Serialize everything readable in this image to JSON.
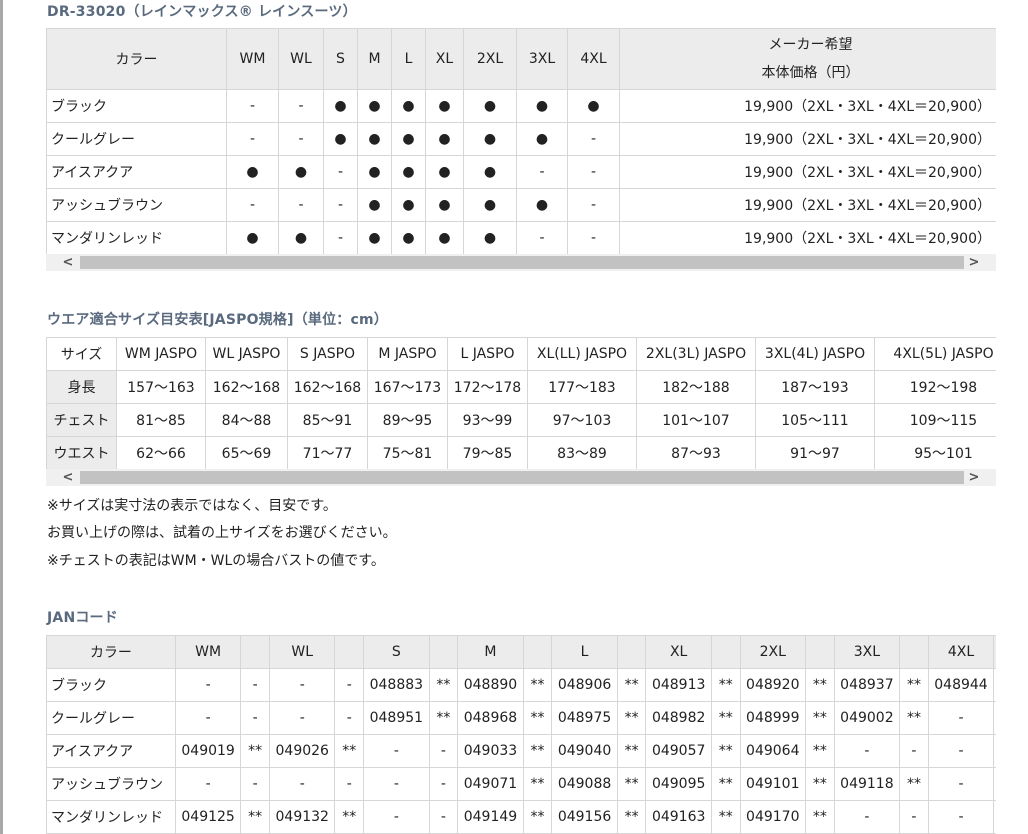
{
  "headings": {
    "model": "DR-33020（レインマックス® レインスーツ）",
    "size_chart": "ウエア適合サイズ目安表[JASPO規格]（単位：cm）",
    "jan": "JANコード"
  },
  "colors_table": {
    "header": [
      "カラー",
      "WM",
      "WL",
      "S",
      "M",
      "L",
      "XL",
      "2XL",
      "3XL",
      "4XL"
    ],
    "price_header_line1": "メーカー希望",
    "price_header_line2": "本体価格（円）",
    "rows": [
      {
        "cells": [
          "ブラック",
          "-",
          "-",
          "●",
          "●",
          "●",
          "●",
          "●",
          "●",
          "●"
        ],
        "price": "19,900（2XL・3XL・4XL＝20,900）"
      },
      {
        "cells": [
          "クールグレー",
          "-",
          "-",
          "●",
          "●",
          "●",
          "●",
          "●",
          "●",
          "-"
        ],
        "price": "19,900（2XL・3XL・4XL＝20,900）"
      },
      {
        "cells": [
          "アイスアクア",
          "●",
          "●",
          "-",
          "●",
          "●",
          "●",
          "●",
          "-",
          "-"
        ],
        "price": "19,900（2XL・3XL・4XL＝20,900）"
      },
      {
        "cells": [
          "アッシュブラウン",
          "-",
          "-",
          "-",
          "●",
          "●",
          "●",
          "●",
          "●",
          "-"
        ],
        "price": "19,900（2XL・3XL・4XL＝20,900）"
      },
      {
        "cells": [
          "マンダリンレッド",
          "●",
          "●",
          "-",
          "●",
          "●",
          "●",
          "●",
          "-",
          "-"
        ],
        "price": "19,900（2XL・3XL・4XL＝20,900）"
      }
    ]
  },
  "size_table": {
    "header": [
      "サイズ",
      "WM JASPO",
      "WL JASPO",
      "S JASPO",
      "M JASPO",
      "L JASPO",
      "XL(LL) JASPO",
      "2XL(3L) JASPO",
      "3XL(4L) JASPO",
      "4XL(5L) JASPO"
    ],
    "rows": [
      [
        "身長",
        "157～163",
        "162～168",
        "162～168",
        "167～173",
        "172～178",
        "177～183",
        "182～188",
        "187～193",
        "192～198"
      ],
      [
        "チェスト",
        "81～85",
        "84～88",
        "85～91",
        "89～95",
        "93～99",
        "97～103",
        "101～107",
        "105～111",
        "109～115"
      ],
      [
        "ウエスト",
        "62～66",
        "65～69",
        "71～77",
        "75～81",
        "79～85",
        "83～89",
        "87～93",
        "91～97",
        "95～101"
      ]
    ]
  },
  "notes": [
    "※サイズは実寸法の表示ではなく、目安です。",
    "お買い上げの際は、試着の上サイズをお選びください。",
    "※チェストの表記はWM・WLの場合バストの値です。"
  ],
  "jan_table": {
    "header": [
      "カラー",
      "WM",
      "",
      "WL",
      "",
      "S",
      "",
      "M",
      "",
      "L",
      "",
      "XL",
      "",
      "2XL",
      "",
      "3XL",
      "",
      "4XL",
      ""
    ],
    "rows": [
      [
        "ブラック",
        "-",
        "-",
        "-",
        "-",
        "048883",
        "**",
        "048890",
        "**",
        "048906",
        "**",
        "048913",
        "**",
        "048920",
        "**",
        "048937",
        "**",
        "048944",
        "**"
      ],
      [
        "クールグレー",
        "-",
        "-",
        "-",
        "-",
        "048951",
        "**",
        "048968",
        "**",
        "048975",
        "**",
        "048982",
        "**",
        "048999",
        "**",
        "049002",
        "**",
        "-",
        "-"
      ],
      [
        "アイスアクア",
        "049019",
        "**",
        "049026",
        "**",
        "-",
        "-",
        "049033",
        "**",
        "049040",
        "**",
        "049057",
        "**",
        "049064",
        "**",
        "-",
        "-",
        "-",
        "-"
      ],
      [
        "アッシュブラウン",
        "-",
        "-",
        "-",
        "-",
        "-",
        "-",
        "049071",
        "**",
        "049088",
        "**",
        "049095",
        "**",
        "049101",
        "**",
        "049118",
        "**",
        "-",
        "-"
      ],
      [
        "マンダリンレッド",
        "049125",
        "**",
        "049132",
        "**",
        "-",
        "-",
        "049149",
        "**",
        "049156",
        "**",
        "049163",
        "**",
        "049170",
        "**",
        "-",
        "-",
        "-",
        "-"
      ]
    ]
  },
  "scrollbar": {
    "left_arrow": "<",
    "right_arrow": ">"
  }
}
